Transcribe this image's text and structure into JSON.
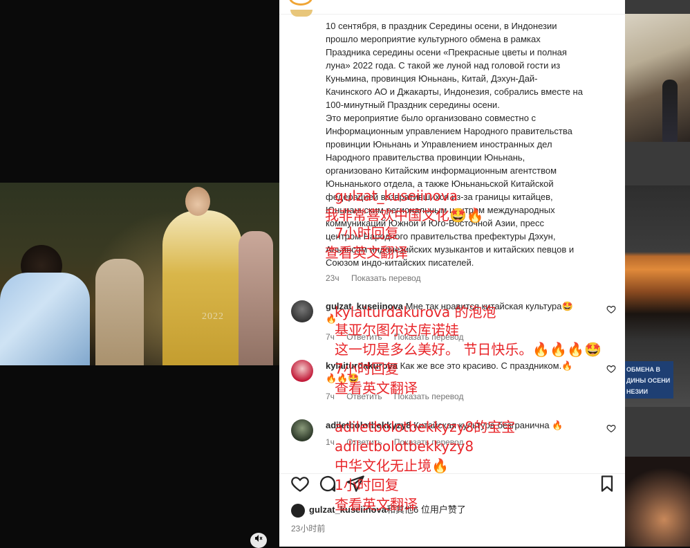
{
  "caption": {
    "lines": [
      "10 сентября, в праздник Середины осени, в Индонезии",
      "прошло мероприятие культурного обмена в рамках",
      "Праздника середины осени «Прекрасные цветы и полная",
      "луна» 2022 года. С такой же луной над головой гости из",
      "Куньмина, провинция Юньнань, Китай, Дэхун-Дай-",
      "Качинского АО и Джакарты, Индонезия, собрались вместе на",
      "100-минутный Праздник середины осени.",
      "Это мероприятие было организовано совместно с",
      "Информационным управлением Народного правительства",
      "провинции Юньнань и Управлением иностранных дел",
      "Народного правительства провинции Юньнань,",
      "организовано Китайским информационным агентством",
      "Юньнанького отдела, а также Юньнаньской Китайской",
      "федерацией возвратившихся из-за границы китайцев,",
      "Юньнаньским региональным центром международных",
      "коммуникаций Южной и Юго-Восточной Азии, пресс",
      "центром Народного правительства префектуры Дэхун,",
      "Альянсом индонезийских музыкантов и китайских певцов и",
      "Союзом индо-китайских писателей."
    ],
    "time": "23ч",
    "translate": "Показать перевод"
  },
  "comments": [
    {
      "user": "gulzat_kuseiinova",
      "text": "Мне так нравится китайская культура🤩",
      "text2": "🔥",
      "time": "7ч",
      "reply": "Ответить",
      "translate": "Показать перевод"
    },
    {
      "user": "kylaiturdakurova",
      "text": "Как же все это красиво. С праздником.🔥",
      "text2": "🔥🔥🤩",
      "time": "7ч",
      "reply": "Ответить",
      "translate": "Показать перевод"
    },
    {
      "user": "adiletbolotbekkyzy8",
      "text": "Китайская культура безгранична 🔥",
      "time": "1ч",
      "reply": "Ответить",
      "translate": "Показать перевод"
    }
  ],
  "overlay": {
    "o1": "gulzat_kuseiinova",
    "o2": "我非常喜欢中国文化🤩🔥",
    "o3": "7小时回复",
    "o4": "查看英文翻译",
    "o5": "kylaiturdakurova 的泡泡",
    "o6": "基亚尔图尔达库诺娃",
    "o7": "这一切是多么美好。 节日快乐。🔥🔥🔥🤩",
    "o8": "7小时回复",
    "o9": "查看英文翻译",
    "o10": "adiletbolotbekkyzy8的宝宝",
    "o11": "adiletbolotbekkyzy8",
    "o12": "中华文化无止境🔥",
    "o13": "1小时回复",
    "o14": "查看英文翻译"
  },
  "likes": {
    "user": "gulzat_kuseiinova",
    "rest": "和其他6 位用户赞了"
  },
  "post_time": "23小时前",
  "video": {
    "watermark": "2022"
  },
  "bg_badge": {
    "lines": [
      "ОБМЕНА В",
      "ДИНЫ ОСЕНИ",
      "НЕЗИИ"
    ]
  },
  "icons": {
    "mute": "muted-speaker-icon",
    "heart": "heart-icon",
    "comment": "comment-icon",
    "share": "paper-plane-icon",
    "save": "bookmark-icon"
  },
  "colors": {
    "overlay": "#e8262a",
    "text": "#262626",
    "meta": "#737373"
  }
}
